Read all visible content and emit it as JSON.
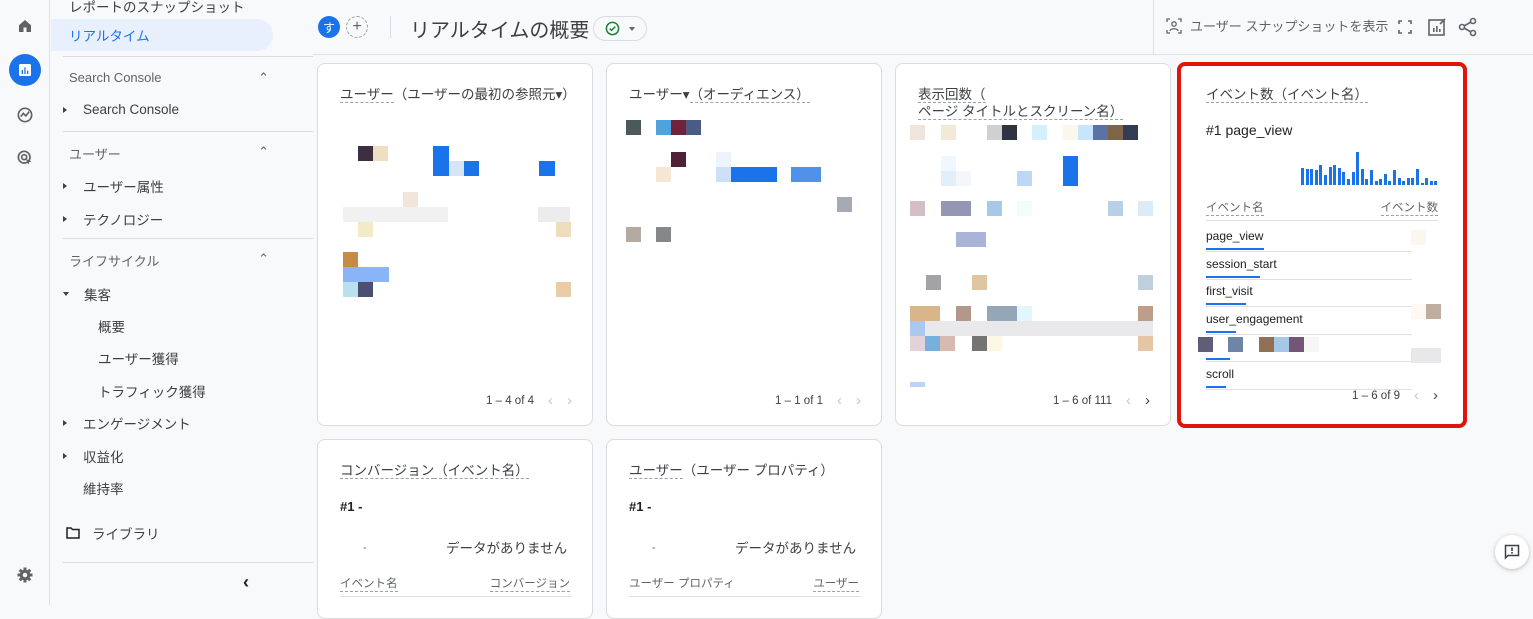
{
  "sidebar": {
    "partial_top": "レポートのスナップショット",
    "realtime": "リアルタイム",
    "sections": [
      {
        "title": "Search Console",
        "items": [
          {
            "label": "Search Console",
            "expander": "right"
          }
        ]
      },
      {
        "title": "ユーザー",
        "items": [
          {
            "label": "ユーザー属性",
            "expander": "right"
          },
          {
            "label": "テクノロジー",
            "expander": "right"
          }
        ]
      },
      {
        "title": "ライフサイクル",
        "items": [
          {
            "label": "集客",
            "expander": "down"
          },
          {
            "label": "概要"
          },
          {
            "label": "ユーザー獲得"
          },
          {
            "label": "トラフィック獲得"
          },
          {
            "label": "エンゲージメント",
            "expander": "right"
          },
          {
            "label": "収益化",
            "expander": "right"
          },
          {
            "label": "維持率"
          }
        ]
      }
    ],
    "library": "ライブラリ"
  },
  "topbar": {
    "avatar_letter": "す",
    "title": "リアルタイムの概要",
    "snapshot_label": "ユーザー スナップショットを表示"
  },
  "cards": {
    "users_source": {
      "title_metric": "ユーザー",
      "title_dim": "（ユーザーの最初の参照元▾）",
      "pager": "1 – 4 of 4"
    },
    "users_audience": {
      "title_metric": "ユーザー▾",
      "title_dim": "（オーディエンス）",
      "pager": "1 – 1 of 1"
    },
    "views": {
      "title_line1": "表示回数（",
      "title_line2": "ページ タイトルとスクリーン名）",
      "pager": "1 – 6 of 111"
    },
    "events": {
      "title_metric": "イベント数",
      "title_dim": "（イベント名）",
      "top": "#1  page_view",
      "col_name": "イベント名",
      "col_count": "イベント数",
      "rows": [
        {
          "name": "page_view",
          "share": 0.29
        },
        {
          "name": "session_start",
          "share": 0.27
        },
        {
          "name": "first_visit",
          "share": 0.2
        },
        {
          "name": "user_engagement",
          "share": 0.15
        },
        {
          "name": "",
          "share": 0.12
        },
        {
          "name": "scroll",
          "share": 0.1
        }
      ],
      "pager": "1 – 6 of 9",
      "sparkline": [
        14,
        13,
        13,
        12,
        16,
        8,
        15,
        16,
        14,
        11,
        5,
        11,
        27,
        13,
        5,
        12,
        3,
        5,
        9,
        3,
        12,
        6,
        3,
        6,
        6,
        13,
        2,
        6,
        3,
        3
      ]
    },
    "conversions": {
      "title_metric": "コンバージョン",
      "title_dim": "（イベント名）",
      "top": "#1  -",
      "dash": "-",
      "nodata": "データがありません",
      "col_name": "イベント名",
      "col_count": "コンバージョン"
    },
    "user_property": {
      "title_metric": "ユーザー",
      "title_dim": "（ユーザー プロパティ）",
      "top": "#1  -",
      "dash": "-",
      "nodata": "データがありません",
      "col_name": "ユーザー プロパティ",
      "col_count": "ユーザー"
    }
  }
}
